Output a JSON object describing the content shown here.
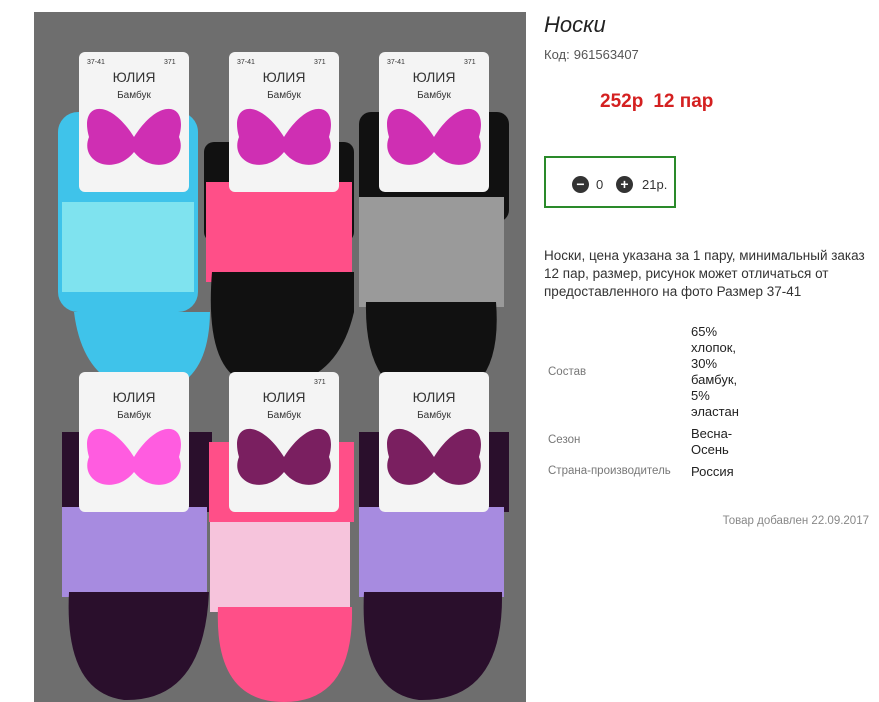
{
  "product": {
    "title": "Носки",
    "code_label": "Код:",
    "code_value": "961563407",
    "price": "252р",
    "price_pack": "12 пар",
    "quantity": {
      "minus_symbol": "−",
      "plus_symbol": "+",
      "value": "0",
      "total": "21р."
    },
    "description": "Носки, цена указана за 1 пару, минимальный заказ 12 пар, размер, рисунок может отличаться от предоставленного на фото Размер 37-41",
    "properties": [
      {
        "label": "Состав",
        "value": "65% хлопок, 30% бамбук, 5% эластан"
      },
      {
        "label": "Сезон",
        "value": "Весна-Осень"
      },
      {
        "label": "Страна-производитель",
        "value": "Россия"
      }
    ],
    "added": "Товар добавлен 22.09.2017"
  },
  "photo": {
    "brand": "ЮЛИЯ",
    "subbrand": "Бамбук",
    "size": "37-41",
    "article": "371",
    "colors": {
      "background": "#6e6e6e",
      "sky_blue": "#3fc3ea",
      "pink": "#ff4f88",
      "black": "#111111",
      "grey": "#9a9a9a",
      "lavender": "#a78be0",
      "dark_purple": "#2a0f2c",
      "butterfly": "#cf2fb3"
    }
  },
  "colors": {
    "price_red": "#d42020",
    "qty_border": "#2a8a2a"
  }
}
